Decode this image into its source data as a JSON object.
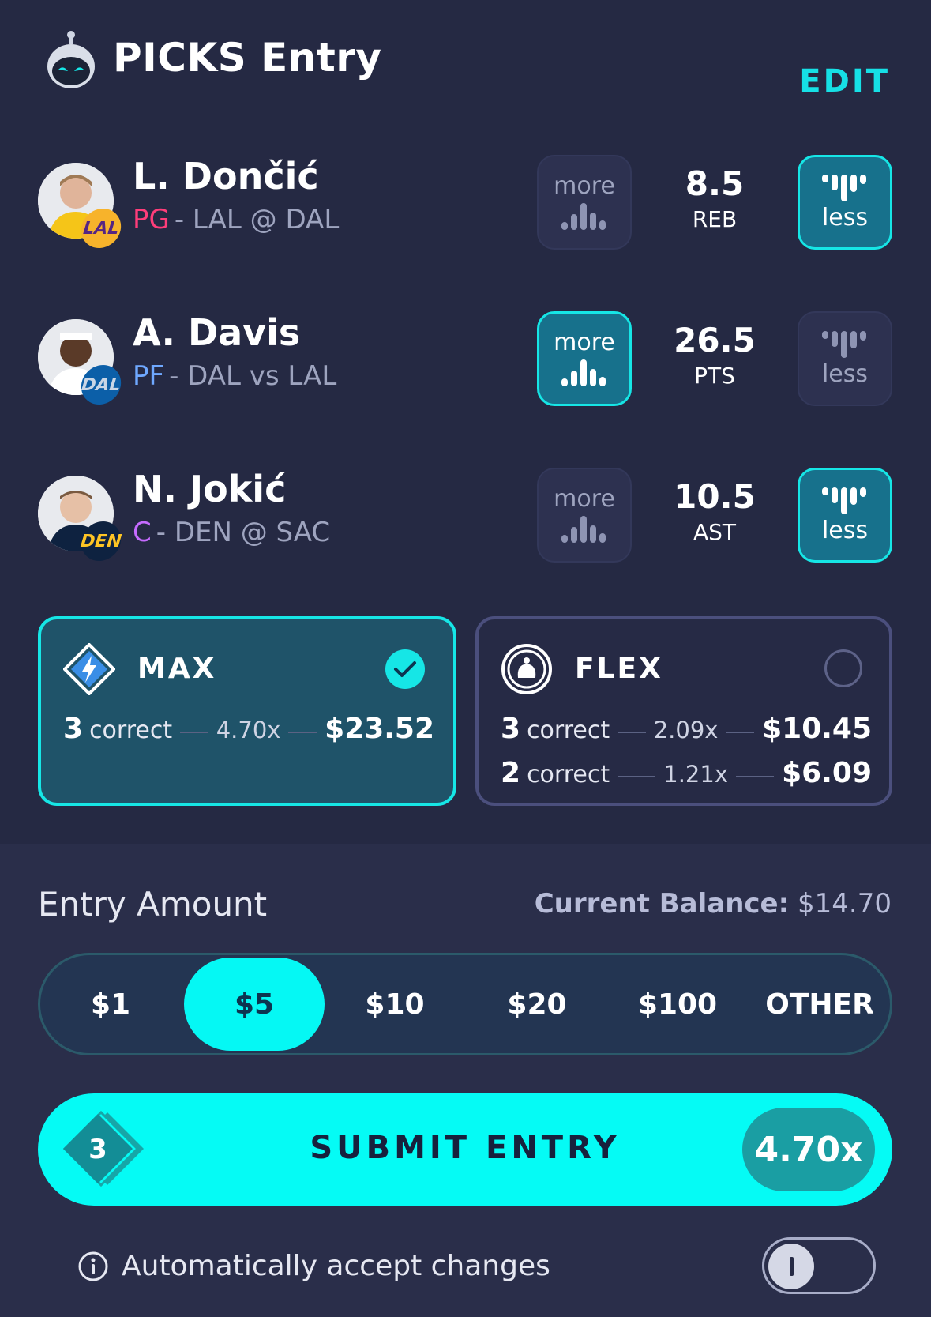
{
  "header": {
    "title": "PICKS Entry",
    "edit_label": "EDIT"
  },
  "players": [
    {
      "name": "L. Dončić",
      "position": "PG",
      "matchup": "- LAL @ DAL",
      "team_badge": "LAL",
      "line": "8.5",
      "stat": "REB",
      "more_label": "more",
      "less_label": "less",
      "selected": "less",
      "position_color": "#ff3d7a",
      "badge_color": "#f7b32b",
      "badge_text_color": "#552583"
    },
    {
      "name": "A. Davis",
      "position": "PF",
      "matchup": "- DAL vs LAL",
      "team_badge": "DAL",
      "line": "26.5",
      "stat": "PTS",
      "more_label": "more",
      "less_label": "less",
      "selected": "more",
      "position_color": "#6fa8ff",
      "badge_color": "#0c5fa8",
      "badge_text_color": "#c9d6e6"
    },
    {
      "name": "N. Jokić",
      "position": "C",
      "matchup": "- DEN @ SAC",
      "team_badge": "DEN",
      "line": "10.5",
      "stat": "AST",
      "more_label": "more",
      "less_label": "less",
      "selected": "less",
      "position_color": "#c66bff",
      "badge_color": "#0e2240",
      "badge_text_color": "#fec524"
    }
  ],
  "cards": {
    "max": {
      "label": "MAX",
      "selected": true,
      "payouts": [
        {
          "count": "3",
          "word": "correct",
          "multiplier": "4.70x",
          "amount": "$23.52"
        }
      ]
    },
    "flex": {
      "label": "FLEX",
      "selected": false,
      "payouts": [
        {
          "count": "3",
          "word": "correct",
          "multiplier": "2.09x",
          "amount": "$10.45"
        },
        {
          "count": "2",
          "word": "correct",
          "multiplier": "1.21x",
          "amount": "$6.09"
        }
      ]
    }
  },
  "entry": {
    "label": "Entry Amount",
    "balance_label": "Current Balance:",
    "balance_value": "$14.70",
    "options": [
      "$1",
      "$5",
      "$10",
      "$20",
      "$100",
      "OTHER"
    ],
    "selected": "$5"
  },
  "submit": {
    "count": "3",
    "label": "SUBMIT ENTRY",
    "multiplier": "4.70x"
  },
  "auto_accept": {
    "label": "Automatically accept changes",
    "enabled": false
  },
  "colors": {
    "accent": "#05fbf5",
    "background": "#252943",
    "card_selected": "#1f5369"
  }
}
